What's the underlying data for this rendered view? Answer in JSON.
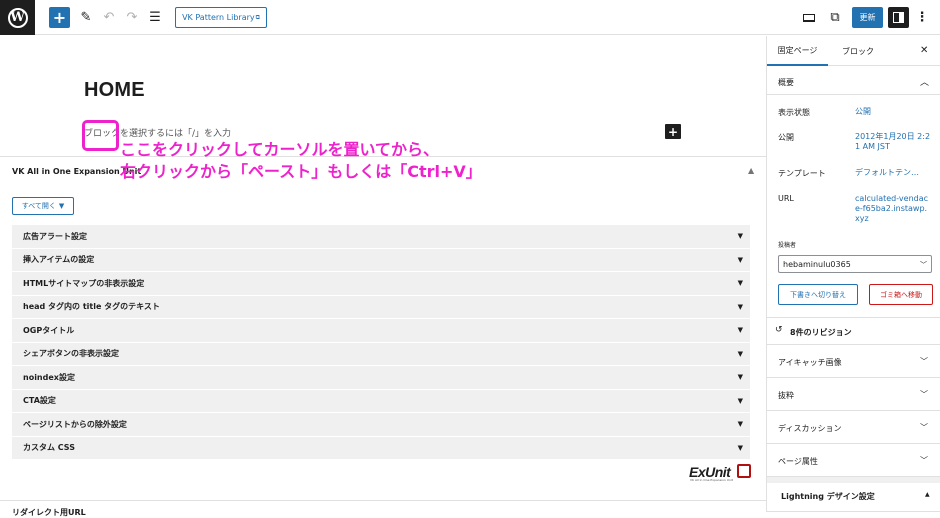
{
  "topbar": {
    "vk_pattern_library": "VK Pattern Library",
    "update_label": "更新",
    "external_icon": "⧉"
  },
  "canvas": {
    "page_title": "HOME",
    "block_placeholder": "ブロックを選択するには「/」を入力",
    "annotation_line1": "ここをクリックしてカーソルを置いてから、",
    "annotation_line2": "右クリックから「ペースト」もしくは「Ctrl+V」",
    "annotation_color": "#ee22cc"
  },
  "metabox": {
    "title": "VK All in One Expansion Unit",
    "open_all_label": "すべて開く",
    "items": [
      "広告アラート設定",
      "挿入アイテムの設定",
      "HTMLサイトマップの非表示設定",
      "head タグ内の title タグのテキスト",
      "OGPタイトル",
      "シェアボタンの非表示設定",
      "noindex設定",
      "CTA設定",
      "ページリストからの除外設定",
      "カスタム CSS"
    ],
    "logo_text": "ExUnit",
    "logo_subtext": "VK All in One Expansion Unit",
    "next_section_title": "リダイレクト用URL"
  },
  "sidebar": {
    "tab_page": "固定ページ",
    "tab_block": "ブロック",
    "summary_title": "概要",
    "visibility_label": "表示状態",
    "visibility_value": "公開",
    "publish_label": "公開",
    "publish_value": "2012年1月20日 2:21 AM JST",
    "template_label": "テンプレート",
    "template_value": "デフォルトテン…",
    "url_label": "URL",
    "url_value": "calculated-vendace-f65ba2.instawp.xyz",
    "author_label": "投稿者",
    "author_value": "hebaminulu0365",
    "draft_button": "下書きへ切り替え",
    "trash_button": "ゴミ箱へ移動",
    "revisions_label": "8件のリビジョン",
    "featured_image": "アイキャッチ画像",
    "excerpt": "抜粋",
    "discussion": "ディスカッション",
    "page_attributes": "ページ属性",
    "lightning_design": "Lightning デザイン設定"
  },
  "colors": {
    "accent": "#2271b1",
    "danger": "#cc1818",
    "dark": "#1e1e1e"
  }
}
